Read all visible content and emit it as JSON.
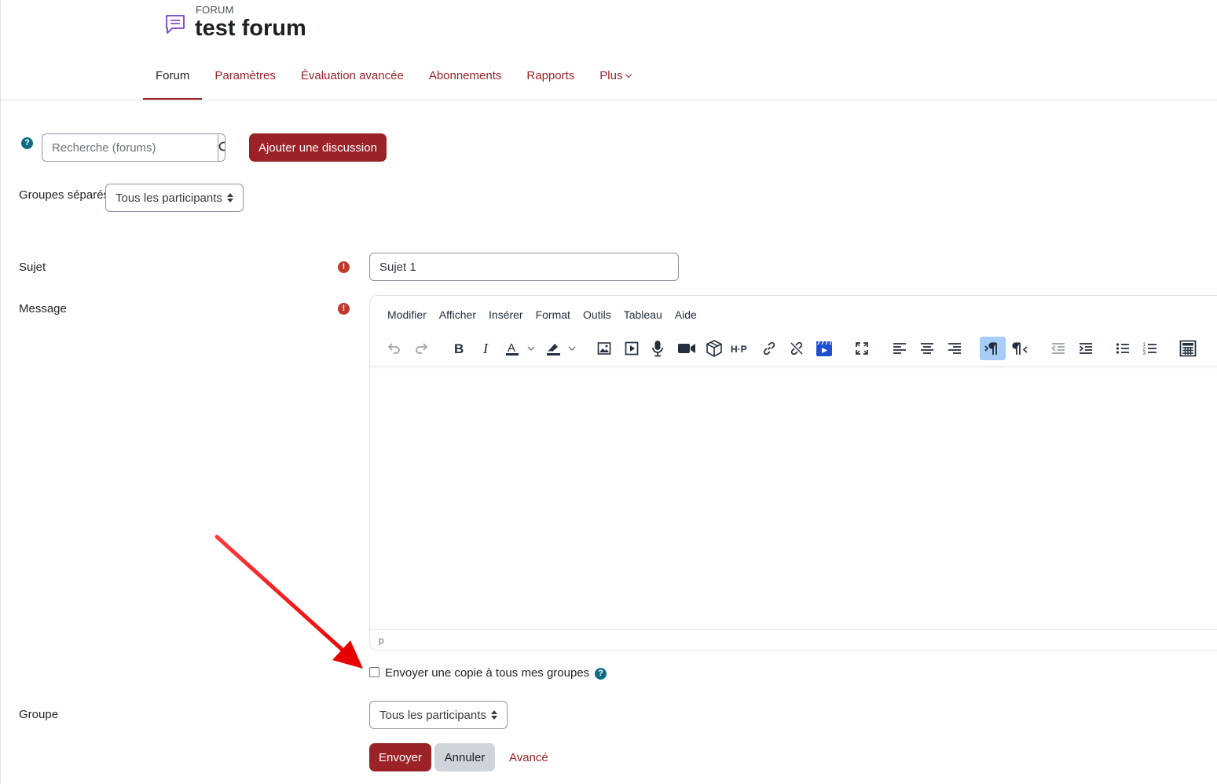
{
  "header": {
    "kicker": "FORUM",
    "title": "test forum",
    "icon": "forum-icon"
  },
  "nav": {
    "items": [
      {
        "label": "Forum",
        "active": true
      },
      {
        "label": "Paramètres",
        "active": false
      },
      {
        "label": "Évaluation avancée",
        "active": false
      },
      {
        "label": "Abonnements",
        "active": false
      },
      {
        "label": "Rapports",
        "active": false
      }
    ],
    "more_label": "Plus"
  },
  "search": {
    "placeholder": "Recherche (forums)"
  },
  "add_discussion_label": "Ajouter une discussion",
  "groups_mode": {
    "label": "Groupes séparés",
    "selected": "Tous les participants"
  },
  "form": {
    "subject": {
      "label": "Sujet",
      "value": "Sujet 1"
    },
    "message": {
      "label": "Message"
    },
    "editor": {
      "menu": [
        "Modifier",
        "Afficher",
        "Insérer",
        "Format",
        "Outils",
        "Tableau",
        "Aide"
      ],
      "statusbar_path": "p"
    },
    "copy_to_groups": {
      "label": "Envoyer une copie à tous mes groupes",
      "checked": false
    },
    "group": {
      "label": "Groupe",
      "selected": "Tous les participants"
    },
    "submit_label": "Envoyer",
    "cancel_label": "Annuler",
    "advanced_label": "Avancé"
  },
  "colors": {
    "brand": "#9b2226",
    "help": "#0f6b84",
    "required": "#c0392b",
    "annotation_arrow": "#ee1111"
  }
}
